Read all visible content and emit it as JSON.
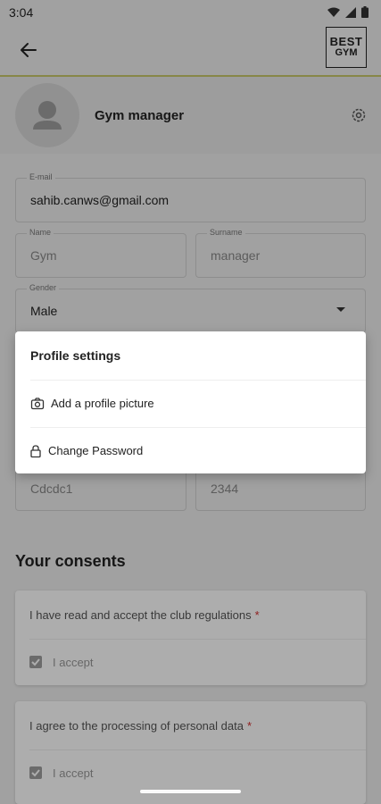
{
  "status_bar": {
    "time": "3:04"
  },
  "app_bar": {
    "logo_line1": "BEST",
    "logo_line2": "GYM"
  },
  "profile": {
    "name": "Gym manager"
  },
  "form": {
    "email": {
      "label": "E-mail",
      "value": "sahib.canws@gmail.com"
    },
    "name": {
      "label": "Name",
      "value": "Gym"
    },
    "surname": {
      "label": "Surname",
      "value": "manager"
    },
    "gender": {
      "label": "Gender",
      "value": "Male"
    },
    "field_left": {
      "value": "Cdcdc1"
    },
    "field_right": {
      "value": "2344"
    }
  },
  "consents": {
    "title": "Your consents",
    "items": [
      {
        "text": "I have read and accept the club regulations",
        "required": "*",
        "accept_label": "I accept",
        "checked": true
      },
      {
        "text": "I agree to the processing of personal data",
        "required": "*",
        "accept_label": "I accept",
        "checked": true
      }
    ]
  },
  "modal": {
    "title": "Profile settings",
    "items": [
      {
        "label": "Add a profile picture",
        "icon": "camera-icon"
      },
      {
        "label": "Change Password",
        "icon": "lock-icon"
      }
    ]
  },
  "colors": {
    "accent_line": "#c8c86a",
    "required": "#d32f2f"
  }
}
